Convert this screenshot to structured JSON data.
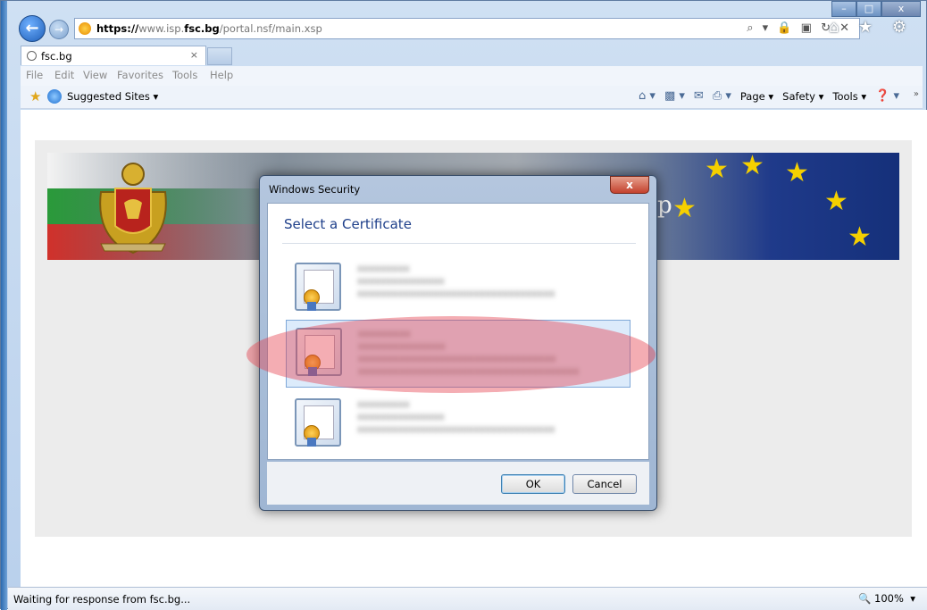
{
  "window": {
    "caption_buttons": [
      "–",
      "□",
      "x"
    ]
  },
  "address_bar": {
    "scheme": "https://",
    "pre_host": "www.isp.",
    "host": "fsc.bg",
    "path": "/portal.nsf/main.xsp",
    "icons": "⌕ ▾ 🔒 ▣ ↻ ✕"
  },
  "right_icons": "⌂ ★ ⚙",
  "tab": {
    "title": "fsc.bg",
    "close": "×"
  },
  "menu": [
    "File",
    "Edit",
    "View",
    "Favorites",
    "Tools",
    "Help"
  ],
  "favorites_bar": {
    "suggested": "Suggested Sites ▾",
    "commands": [
      "Page ▾",
      "Safety ▾",
      "Tools ▾"
    ],
    "more": "»"
  },
  "banner": {
    "partial_text": "p"
  },
  "dialog": {
    "title": "Windows Security",
    "close": "x",
    "heading": "Select a Certificate",
    "certificates": [
      {
        "lines": [
          "xxxxxxxxx",
          "xxxxxxxxxxxxxxx",
          "xxxxxxxxxxxxxxxxxxxxxxxxxxxxxxxxxx"
        ],
        "selected": false
      },
      {
        "lines": [
          "xxxxxxxxx",
          "xxxxxxxxxxxxxxx",
          "xxxxxxxxxxxxxxxxxxxxxxxxxxxxxxxxxx",
          "xxxxxxxxxxxxxxxxxxxxxxxxxxxxxxxxxxxxxx"
        ],
        "selected": true
      },
      {
        "lines": [
          "xxxxxxxxx",
          "xxxxxxxxxxxxxxx",
          "xxxxxxxxxxxxxxxxxxxxxxxxxxxxxxxxxx"
        ],
        "selected": false
      }
    ],
    "ok_label": "OK",
    "cancel_label": "Cancel"
  },
  "status_bar": {
    "text": "Waiting for response from fsc.bg...",
    "zoom": "100%",
    "zoom_arrow": "▾"
  },
  "colors": {
    "highlight": "#e53c4b",
    "dialog_heading": "#1e3f8a",
    "selected_row": "#dcebfb"
  }
}
